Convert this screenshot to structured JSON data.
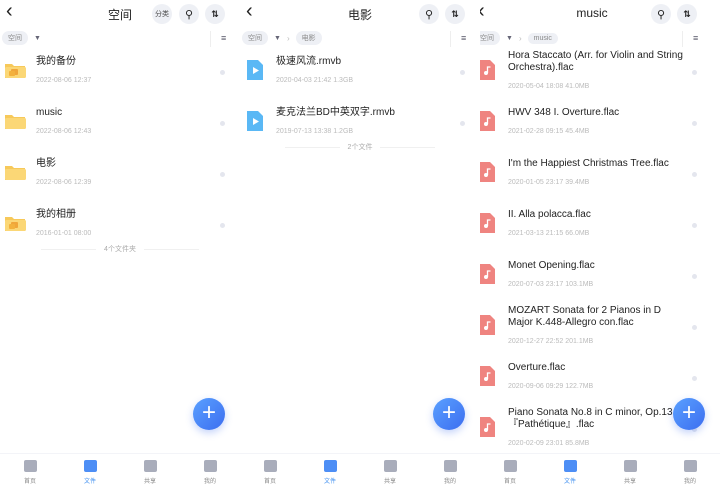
{
  "colors": {
    "accent": "#3d8ef0",
    "folder": "#f7c95a",
    "video": "#5ab8f5",
    "audio": "#ef8480"
  },
  "nav": [
    "首页",
    "文件",
    "共享",
    "我的"
  ],
  "panels": [
    {
      "title": "空间",
      "category_label": "分类",
      "crumbs": [
        "空间"
      ],
      "footer": "4个文件夹",
      "items": [
        {
          "type": "folder-special",
          "name": "我的备份",
          "meta": "2022-08-06 12:37"
        },
        {
          "type": "folder",
          "name": "music",
          "meta": "2022-08-06 12:43"
        },
        {
          "type": "folder",
          "name": "电影",
          "meta": "2022-08-06 12:39"
        },
        {
          "type": "folder-special",
          "name": "我的相册",
          "meta": "2016-01-01 08:00"
        }
      ]
    },
    {
      "title": "电影",
      "crumbs": [
        "空间",
        "电影"
      ],
      "footer": "2个文件",
      "items": [
        {
          "type": "video",
          "name": "极速风流.rmvb",
          "meta": "2020-04-03 21:42  1.3GB"
        },
        {
          "type": "video",
          "name": "麦克法兰BD中英双字.rmvb",
          "meta": "2019-07-13 13:38  1.2GB"
        }
      ]
    },
    {
      "title": "music",
      "crumbs": [
        "空间",
        "music"
      ],
      "items": [
        {
          "type": "audio",
          "name": "Hora Staccato (Arr. for Violin and String Orchestra).flac",
          "meta": "2020-05-04 18:08  41.0MB"
        },
        {
          "type": "audio",
          "name": "HWV 348 I. Overture.flac",
          "meta": "2021-02-28 09:15  45.4MB"
        },
        {
          "type": "audio",
          "name": "I'm the Happiest Christmas Tree.flac",
          "meta": "2020-01-05 23:17  39.4MB"
        },
        {
          "type": "audio",
          "name": "II. Alla polacca.flac",
          "meta": "2021-03-13 21:15  66.0MB"
        },
        {
          "type": "audio",
          "name": "Monet Opening.flac",
          "meta": "2020-07-03 23:17  103.1MB"
        },
        {
          "type": "audio",
          "name": "MOZART Sonata for 2 Pianos in D Major K.448-Allegro con.flac",
          "meta": "2020-12-27 22:52  201.1MB"
        },
        {
          "type": "audio",
          "name": "Overture.flac",
          "meta": "2020-09-06 09:29  122.7MB"
        },
        {
          "type": "audio",
          "name": "Piano Sonata No.8 in C minor, Op.13 『Pathétique』.flac",
          "meta": "2020-02-09 23:01  85.8MB"
        }
      ]
    }
  ]
}
